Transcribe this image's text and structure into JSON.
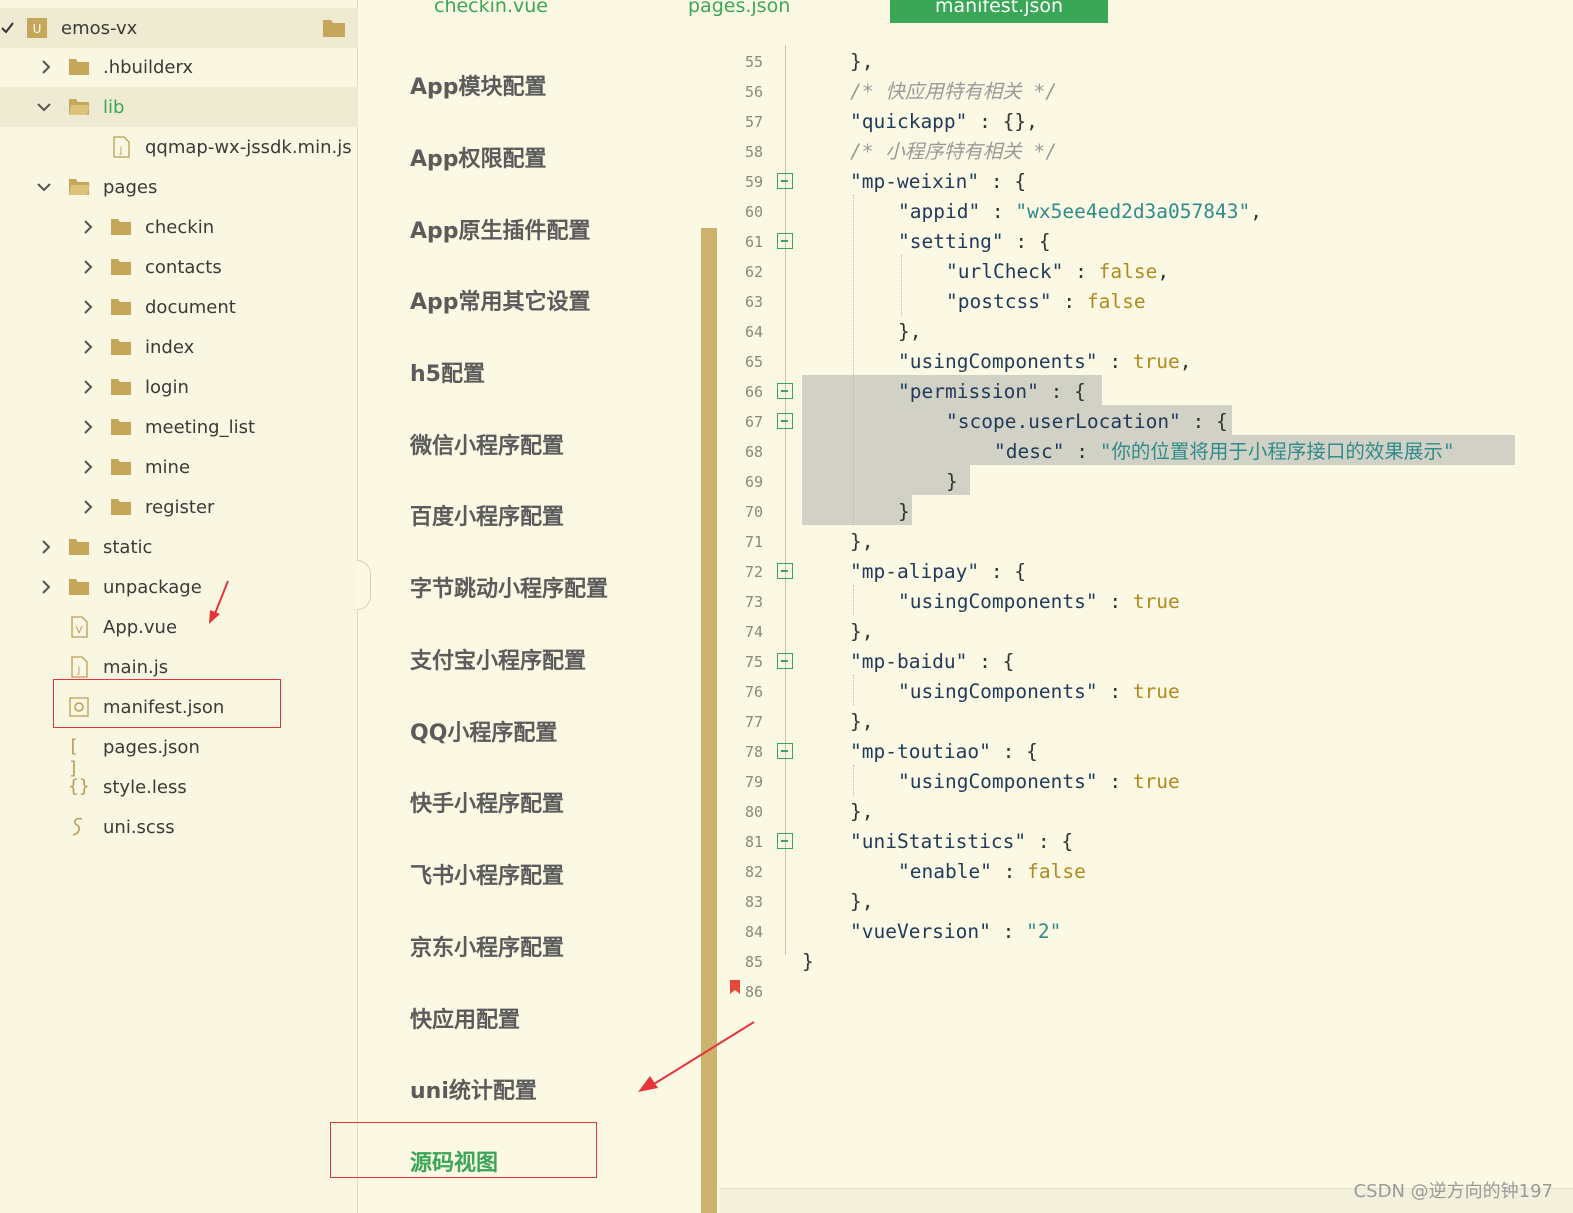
{
  "tabs": [
    {
      "label": "checkin.vue"
    },
    {
      "label": "pages.json"
    },
    {
      "label": "manifest.json",
      "active": true
    }
  ],
  "sidebar": {
    "project": "emos-vx",
    "items": [
      {
        "label": ".hbuilderx",
        "type": "folder",
        "expanded": false
      },
      {
        "label": "lib",
        "type": "folder",
        "expanded": true
      },
      {
        "label": "qqmap-wx-jssdk.min.js",
        "type": "file-js"
      },
      {
        "label": "pages",
        "type": "folder",
        "expanded": true
      },
      {
        "label": "checkin",
        "type": "folder",
        "expanded": false
      },
      {
        "label": "contacts",
        "type": "folder",
        "expanded": false
      },
      {
        "label": "document",
        "type": "folder",
        "expanded": false
      },
      {
        "label": "index",
        "type": "folder",
        "expanded": false
      },
      {
        "label": "login",
        "type": "folder",
        "expanded": false
      },
      {
        "label": "meeting_list",
        "type": "folder",
        "expanded": false
      },
      {
        "label": "mine",
        "type": "folder",
        "expanded": false
      },
      {
        "label": "register",
        "type": "folder",
        "expanded": false
      },
      {
        "label": "static",
        "type": "folder",
        "expanded": false
      },
      {
        "label": "unpackage",
        "type": "folder",
        "expanded": false
      },
      {
        "label": "App.vue",
        "type": "file-vue"
      },
      {
        "label": "main.js",
        "type": "file-js"
      },
      {
        "label": "manifest.json",
        "type": "file-manifest"
      },
      {
        "label": "pages.json",
        "type": "file-json"
      },
      {
        "label": "style.less",
        "type": "file-less"
      },
      {
        "label": "uni.scss",
        "type": "file-scss"
      }
    ]
  },
  "confignav": {
    "items": [
      "App模块配置",
      "App权限配置",
      "App原生插件配置",
      "App常用其它设置",
      "h5配置",
      "微信小程序配置",
      "百度小程序配置",
      "字节跳动小程序配置",
      "支付宝小程序配置",
      "QQ小程序配置",
      "快手小程序配置",
      "飞书小程序配置",
      "京东小程序配置",
      "快应用配置",
      "uni统计配置",
      "源码视图"
    ],
    "active": "源码视图"
  },
  "editor": {
    "line_numbers": [
      "55",
      "56",
      "57",
      "58",
      "59",
      "60",
      "61",
      "62",
      "63",
      "64",
      "65",
      "66",
      "67",
      "68",
      "69",
      "70",
      "71",
      "72",
      "73",
      "74",
      "75",
      "76",
      "77",
      "78",
      "79",
      "80",
      "81",
      "82",
      "83",
      "84",
      "85",
      "86"
    ],
    "lines": {
      "l55": "},",
      "l56": "/* 快应用特有相关 */",
      "l57_key": "\"quickapp\"",
      "l57_rest": " : {},",
      "l58": "/* 小程序特有相关 */",
      "l59_key": "\"mp-weixin\"",
      "l59_rest": " : {",
      "l60_key": "\"appid\"",
      "l60_sep": " : ",
      "l60_val": "\"wx5ee4ed2d3a057843\"",
      "l60_end": ",",
      "l61_key": "\"setting\"",
      "l61_rest": " : {",
      "l62_key": "\"urlCheck\"",
      "l62_sep": " : ",
      "l62_val": "false",
      "l62_end": ",",
      "l63_key": "\"postcss\"",
      "l63_sep": " : ",
      "l63_val": "false",
      "l64": "},",
      "l65_key": "\"usingComponents\"",
      "l65_sep": " : ",
      "l65_val": "true",
      "l65_end": ",",
      "l66_key": "\"permission\"",
      "l66_rest": " : {",
      "l67_key": "\"scope.userLocation\"",
      "l67_rest": " : {",
      "l68_key": "\"desc\"",
      "l68_sep": " : ",
      "l68_val": "\"你的位置将用于小程序接口的效果展示\"",
      "l69": "}",
      "l70": "}",
      "l71": "},",
      "l72_key": "\"mp-alipay\"",
      "l72_rest": " : {",
      "l73_key": "\"usingComponents\"",
      "l73_sep": " : ",
      "l73_val": "true",
      "l74": "},",
      "l75_key": "\"mp-baidu\"",
      "l75_rest": " : {",
      "l76_key": "\"usingComponents\"",
      "l76_sep": " : ",
      "l76_val": "true",
      "l77": "},",
      "l78_key": "\"mp-toutiao\"",
      "l78_rest": " : {",
      "l79_key": "\"usingComponents\"",
      "l79_sep": " : ",
      "l79_val": "true",
      "l80": "},",
      "l81_key": "\"uniStatistics\"",
      "l81_rest": " : {",
      "l82_key": "\"enable\"",
      "l82_sep": " : ",
      "l82_val": "false",
      "l83": "},",
      "l84_key": "\"vueVersion\"",
      "l84_sep": " : ",
      "l84_val": "\"2\"",
      "l85": "}"
    }
  },
  "watermark": "CSDN @逆方向的钟197",
  "colors": {
    "accent": "#3AA757",
    "annotation": "#E5353A",
    "scrollbar": "#CCB36B",
    "background": "#FBF8E4"
  },
  "icons": {
    "folder": "folder-icon",
    "folder_open": "folder-open-icon",
    "chevron_right": "chevron-right-icon",
    "chevron_down": "chevron-down-icon",
    "fold": "fold-minus-icon",
    "bookmark": "bookmark-icon"
  }
}
